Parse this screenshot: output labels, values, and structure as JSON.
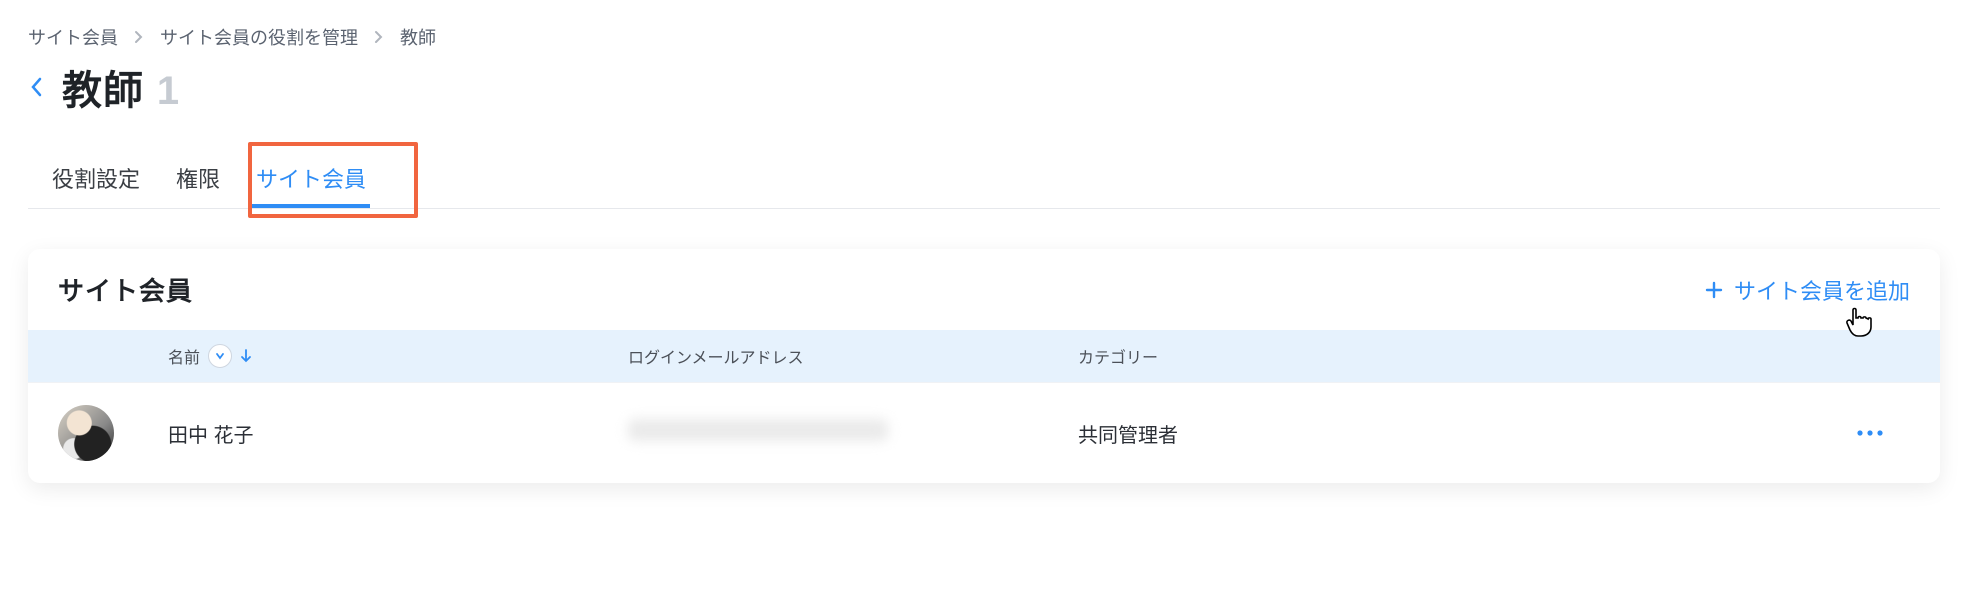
{
  "breadcrumb": {
    "items": [
      "サイト会員",
      "サイト会員の役割を管理",
      "教師"
    ]
  },
  "title": {
    "label": "教師",
    "count": "1"
  },
  "tabs": [
    {
      "label": "役割設定",
      "active": false
    },
    {
      "label": "権限",
      "active": false
    },
    {
      "label": "サイト会員",
      "active": true
    }
  ],
  "panel": {
    "title": "サイト会員",
    "add_label": "サイト会員を追加"
  },
  "table": {
    "headers": {
      "name": "名前",
      "email": "ログインメールアドレス",
      "category": "カテゴリー"
    },
    "rows": [
      {
        "name": "田中 花子",
        "email": "",
        "category": "共同管理者"
      }
    ]
  },
  "icons": {
    "chevron_right": "chevron-right-icon",
    "back": "chevron-left-icon",
    "plus": "plus-icon",
    "sort_asc": "arrow-down-icon",
    "more": "more-horizontal-icon",
    "cursor": "pointer-cursor-icon"
  },
  "colors": {
    "accent": "#2f8df5",
    "highlight": "#f1653f",
    "thead_bg": "#e6f2fd"
  }
}
